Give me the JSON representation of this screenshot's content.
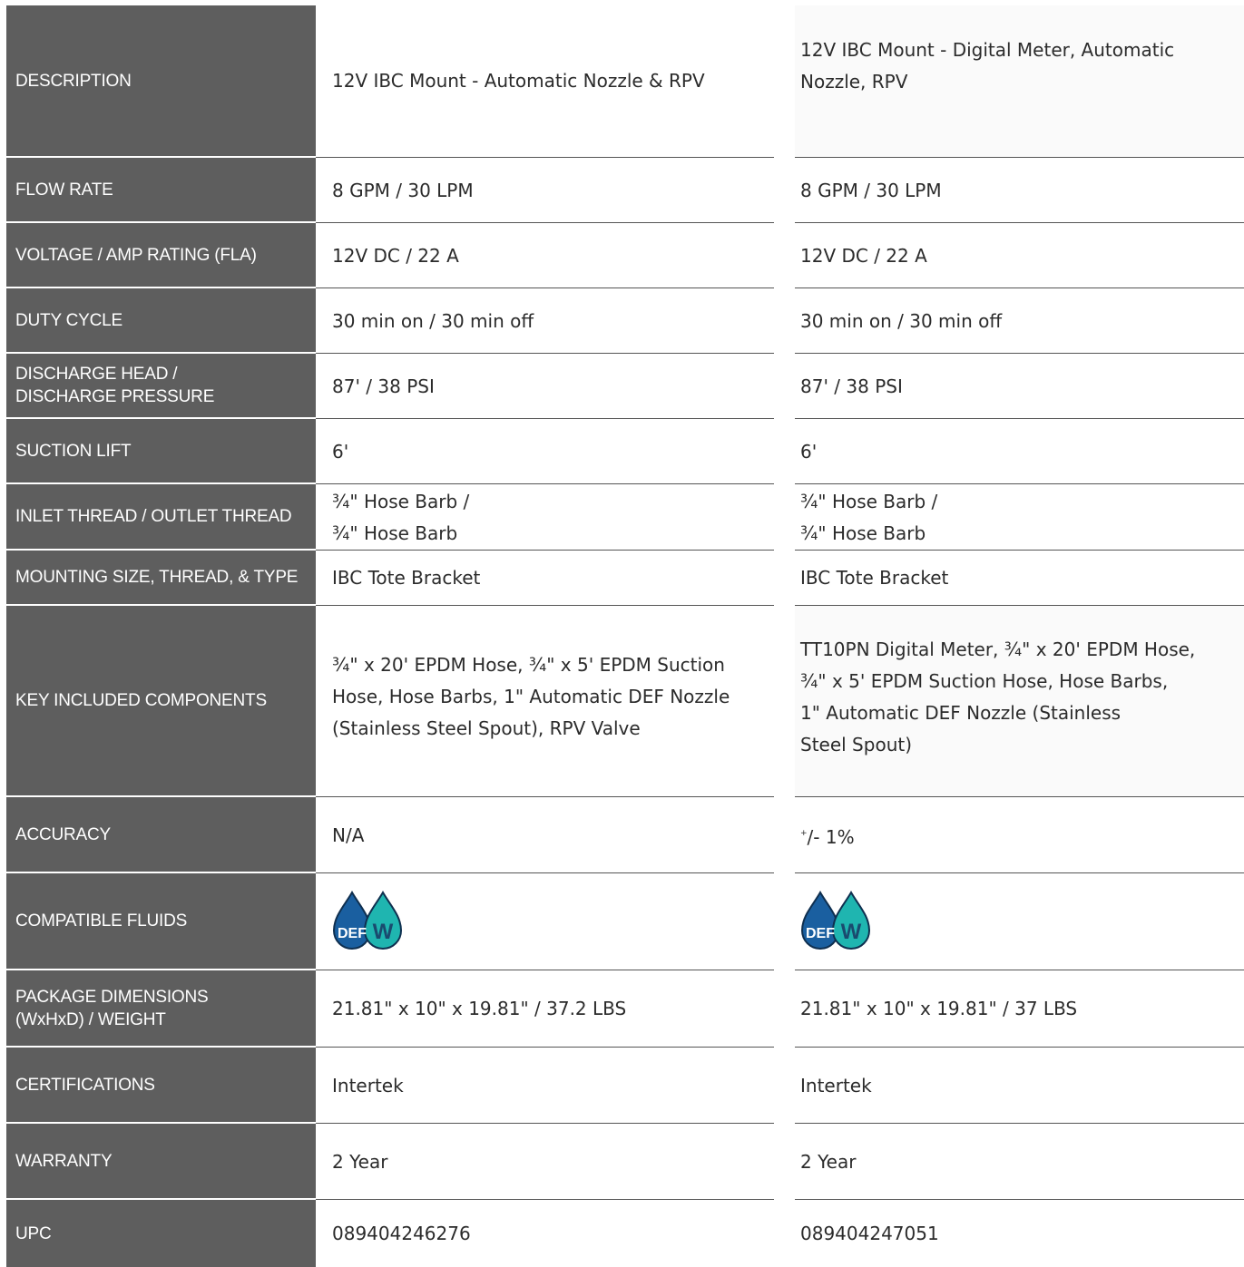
{
  "columns": [
    "12V IBC Mount - Automatic Nozzle & RPV",
    "12V IBC Mount - Digital Meter, Automatic Nozzle, RPV"
  ],
  "rows": [
    {
      "label": "DESCRIPTION",
      "a": "12V IBC Mount - Automatic Nozzle & RPV",
      "b": "12V IBC Mount - Digital Meter, Automatic\nNozzle, RPV"
    },
    {
      "label": "FLOW RATE",
      "a": "8 GPM / 30 LPM",
      "b": "8 GPM / 30 LPM"
    },
    {
      "label": "VOLTAGE / AMP RATING (FLA)",
      "a": "12V DC / 22 A",
      "b": "12V DC / 22 A"
    },
    {
      "label": "DUTY CYCLE",
      "a": "30 min on / 30 min off",
      "b": "30 min on / 30 min off"
    },
    {
      "label": "DISCHARGE HEAD /\nDISCHARGE PRESSURE",
      "a": "87' / 38 PSI",
      "b": "87' / 38 PSI"
    },
    {
      "label": "SUCTION LIFT",
      "a": "6'",
      "b": "6'"
    },
    {
      "label": "INLET THREAD / OUTLET THREAD",
      "a": "¾\" Hose Barb /\n¾\" Hose Barb",
      "b": "¾\" Hose Barb /\n¾\" Hose Barb"
    },
    {
      "label": "MOUNTING SIZE, THREAD, & TYPE",
      "a": "IBC Tote Bracket",
      "b": "IBC Tote Bracket"
    },
    {
      "label": "KEY INCLUDED COMPONENTS",
      "a": "¾\" x 20' EPDM Hose, ¾\" x 5' EPDM Suction\nHose, Hose Barbs, 1\" Automatic DEF Nozzle\n(Stainless Steel Spout), RPV Valve",
      "b": "TT10PN Digital Meter, ¾\" x 20' EPDM Hose,\n¾\" x 5' EPDM Suction Hose, Hose Barbs,\n1\" Automatic DEF Nozzle (Stainless\nSteel Spout)"
    },
    {
      "label": "ACCURACY",
      "a": "N/A",
      "b_sup": "+",
      "b": "/- 1%"
    },
    {
      "label": "COMPATIBLE FLUIDS",
      "icons": {
        "def_label": "DEF",
        "water_label": "W",
        "def_color": "#1a5fa0",
        "water_color": "#1fb5b0"
      }
    },
    {
      "label": "PACKAGE DIMENSIONS\n(WxHxD) / WEIGHT",
      "a": "21.81\" x 10\" x 19.81\" / 37.2 LBS",
      "b": "21.81\" x 10\" x 19.81\" / 37 LBS"
    },
    {
      "label": "CERTIFICATIONS",
      "a": "Intertek",
      "b": "Intertek"
    },
    {
      "label": "WARRANTY",
      "a": "2 Year",
      "b": "2 Year"
    },
    {
      "label": "UPC",
      "a": "089404246276",
      "b": "089404247051"
    }
  ]
}
